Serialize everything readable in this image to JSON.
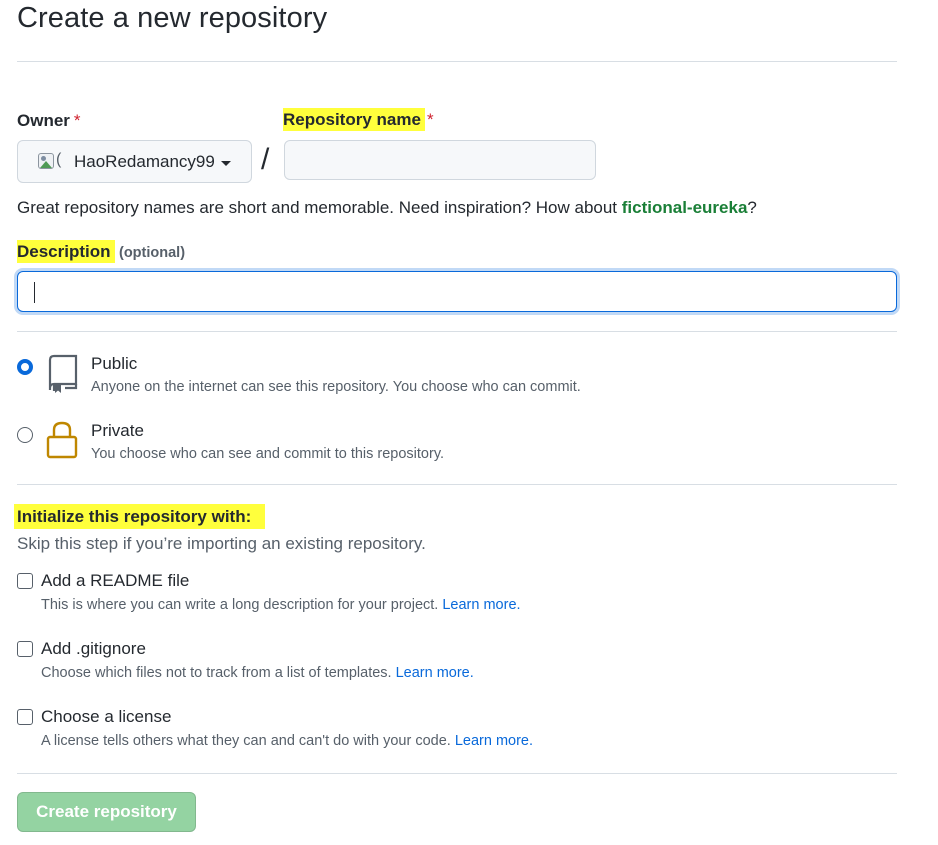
{
  "header": {
    "title": "Create a new repository"
  },
  "owner": {
    "label": "Owner",
    "required_mark": "*",
    "name": "HaoRedamancy99"
  },
  "repo_name": {
    "label": "Repository name",
    "required_mark": "*",
    "value": "",
    "separator": "/"
  },
  "hint": {
    "text": "Great repository names are short and memorable. Need inspiration? How about ",
    "suggestion": "fictional-eureka",
    "suffix": "?"
  },
  "description": {
    "label": "Description",
    "optional": "(optional)",
    "value": ""
  },
  "visibility": {
    "public": {
      "title": "Public",
      "desc": "Anyone on the internet can see this repository. You choose who can commit."
    },
    "private": {
      "title": "Private",
      "desc": "You choose who can see and commit to this repository."
    }
  },
  "init": {
    "heading": "Initialize this repository with:",
    "subheading": "Skip this step if you’re importing an existing repository.",
    "readme": {
      "title": "Add a README file",
      "desc": "This is where you can write a long description for your project. ",
      "link": "Learn more."
    },
    "gitignore": {
      "title": "Add .gitignore",
      "desc": "Choose which files not to track from a list of templates. ",
      "link": "Learn more."
    },
    "license": {
      "title": "Choose a license",
      "desc": "A license tells others what they can and can't do with your code. ",
      "link": "Learn more."
    }
  },
  "submit": {
    "label": "Create repository"
  },
  "colors": {
    "accent": "#0969da",
    "success": "#1a7f37",
    "highlight": "#ffff3c",
    "disabled_button": "#94d3a2"
  }
}
